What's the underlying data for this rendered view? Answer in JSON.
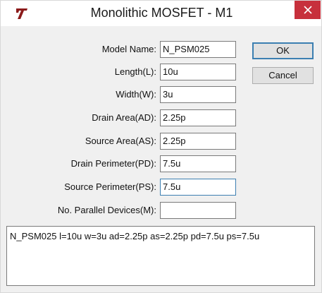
{
  "window": {
    "title": "Monolithic MOSFET - M1",
    "app_icon": "ltspice-logo-icon",
    "close_icon": "close-icon"
  },
  "fields": [
    {
      "label": "Model Name:",
      "value": "N_PSM025"
    },
    {
      "label": "Length(L):",
      "value": "10u"
    },
    {
      "label": "Width(W):",
      "value": "3u"
    },
    {
      "label": "Drain Area(AD):",
      "value": "2.25p"
    },
    {
      "label": "Source Area(AS):",
      "value": "2.25p"
    },
    {
      "label": "Drain Perimeter(PD):",
      "value": "7.5u"
    },
    {
      "label": "Source Perimeter(PS):",
      "value": "7.5u"
    },
    {
      "label": "No. Parallel Devices(M):",
      "value": ""
    }
  ],
  "buttons": {
    "ok": "OK",
    "cancel": "Cancel"
  },
  "spice_line": "N_PSM025 l=10u w=3u ad=2.25p as=2.25p pd=7.5u ps=7.5u",
  "colors": {
    "close_button": "#c7303c",
    "focus_border": "#3c7fb1",
    "dialog_background": "#f0f0f0",
    "logo": "#8b1a1a"
  }
}
